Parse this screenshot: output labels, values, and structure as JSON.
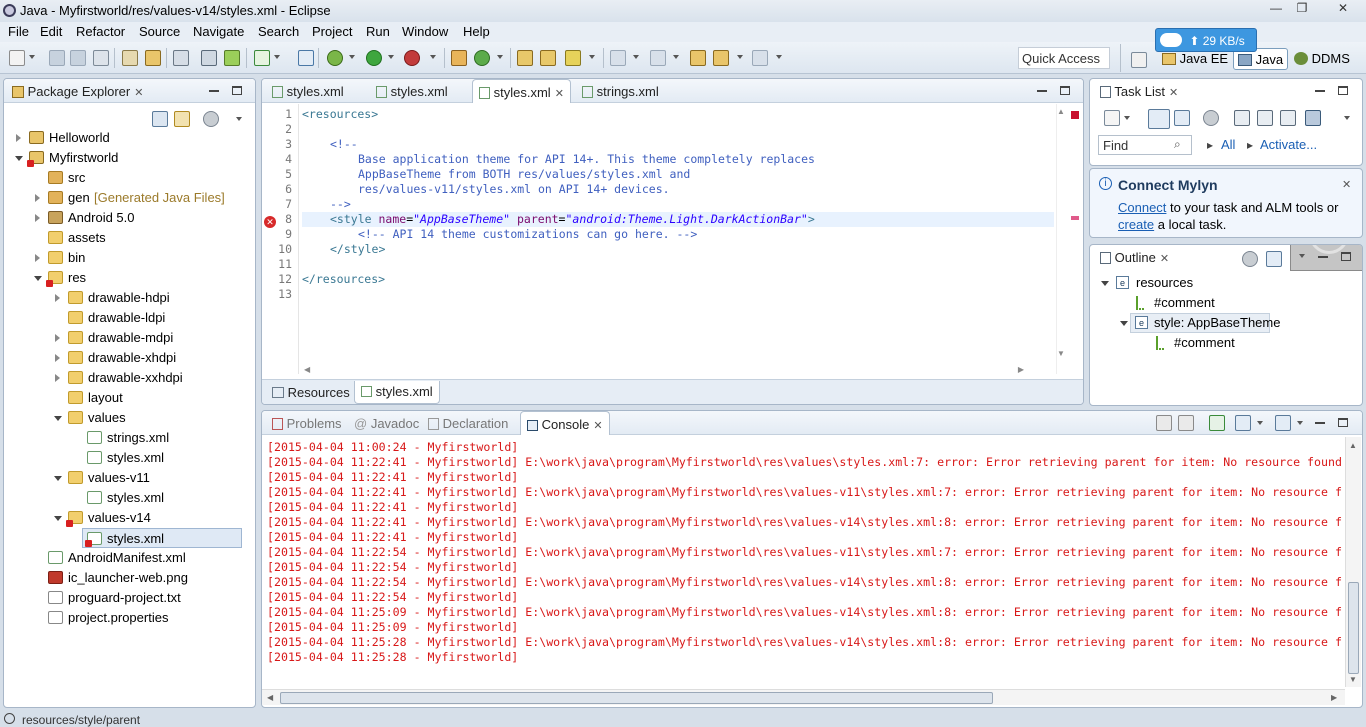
{
  "window": {
    "title": "Java - Myfirstworld/res/values-v14/styles.xml - Eclipse",
    "min": "—",
    "restore": "❐",
    "close": "✕"
  },
  "menu": [
    "File",
    "Edit",
    "Refactor",
    "Source",
    "Navigate",
    "Search",
    "Project",
    "Run",
    "Window",
    "Help"
  ],
  "toolbar": {
    "quick_access": "Quick Access",
    "speed": "⬆ 29 KB/s",
    "perspectives": [
      "Java EE",
      "Java",
      "DDMS"
    ]
  },
  "package_explorer": {
    "title": "Package Explorer",
    "items": [
      {
        "label": "Helloworld"
      },
      {
        "label": "Myfirstworld"
      },
      {
        "label": "src"
      },
      {
        "label": "gen",
        "extra": "[Generated Java Files]"
      },
      {
        "label": "Android 5.0"
      },
      {
        "label": "assets"
      },
      {
        "label": "bin"
      },
      {
        "label": "res"
      },
      {
        "label": "drawable-hdpi"
      },
      {
        "label": "drawable-ldpi"
      },
      {
        "label": "drawable-mdpi"
      },
      {
        "label": "drawable-xhdpi"
      },
      {
        "label": "drawable-xxhdpi"
      },
      {
        "label": "layout"
      },
      {
        "label": "values"
      },
      {
        "label": "strings.xml"
      },
      {
        "label": "styles.xml"
      },
      {
        "label": "values-v11"
      },
      {
        "label": "styles.xml"
      },
      {
        "label": "values-v14"
      },
      {
        "label": "styles.xml"
      },
      {
        "label": "AndroidManifest.xml"
      },
      {
        "label": "ic_launcher-web.png"
      },
      {
        "label": "proguard-project.txt"
      },
      {
        "label": "project.properties"
      }
    ]
  },
  "editor": {
    "tabs": [
      "styles.xml",
      "styles.xml",
      "styles.xml",
      "strings.xml"
    ],
    "line_numbers": [
      "1",
      "2",
      "3",
      "4",
      "5",
      "6",
      "7",
      "8",
      "9",
      "10",
      "11",
      "12",
      "13"
    ],
    "lines": {
      "l1": "<resources>",
      "l3": "<!--",
      "l4": "Base application theme for API 14+. This theme completely replaces",
      "l5": "AppBaseTheme from BOTH res/values/styles.xml and",
      "l6": "res/values-v11/styles.xml on API 14+ devices.",
      "l7": "-->",
      "l8_tag": "<style",
      "l8_a1": "name",
      "l8_v1": "\"AppBaseTheme\"",
      "l8_a2": "parent",
      "l8_v2": "\"android:Theme.Light.DarkActionBar\"",
      "l8_end": ">",
      "l9": "<!-- API 14 theme customizations can go here. -->",
      "l10": "</style>",
      "l12": "</resources>",
      "eq": "="
    },
    "bottom_tabs": [
      "Resources",
      "styles.xml"
    ]
  },
  "tasklist": {
    "title": "Task List",
    "find": "Find",
    "all": "All",
    "activate": "Activate..."
  },
  "mylyn": {
    "title": "Connect Mylyn",
    "connect": "Connect",
    "text1": " to your task and ALM tools or",
    "create": "create",
    "text2": " a local task."
  },
  "outline": {
    "title": "Outline",
    "items": [
      "resources",
      "#comment",
      "style: AppBaseTheme",
      "#comment"
    ]
  },
  "console": {
    "tabs": [
      "Problems",
      "Javadoc",
      "Declaration",
      "Console"
    ],
    "lines": [
      "[2015-04-04 11:00:24 - Myfirstworld]",
      "[2015-04-04 11:22:41 - Myfirstworld] E:\\work\\java\\program\\Myfirstworld\\res\\values\\styles.xml:7: error: Error retrieving parent for item: No resource found",
      "[2015-04-04 11:22:41 - Myfirstworld]",
      "[2015-04-04 11:22:41 - Myfirstworld] E:\\work\\java\\program\\Myfirstworld\\res\\values-v11\\styles.xml:7: error: Error retrieving parent for item: No resource f",
      "[2015-04-04 11:22:41 - Myfirstworld]",
      "[2015-04-04 11:22:41 - Myfirstworld] E:\\work\\java\\program\\Myfirstworld\\res\\values-v14\\styles.xml:8: error: Error retrieving parent for item: No resource f",
      "[2015-04-04 11:22:41 - Myfirstworld]",
      "[2015-04-04 11:22:54 - Myfirstworld] E:\\work\\java\\program\\Myfirstworld\\res\\values-v11\\styles.xml:7: error: Error retrieving parent for item: No resource f",
      "[2015-04-04 11:22:54 - Myfirstworld]",
      "[2015-04-04 11:22:54 - Myfirstworld] E:\\work\\java\\program\\Myfirstworld\\res\\values-v14\\styles.xml:8: error: Error retrieving parent for item: No resource f",
      "[2015-04-04 11:22:54 - Myfirstworld]",
      "[2015-04-04 11:25:09 - Myfirstworld] E:\\work\\java\\program\\Myfirstworld\\res\\values-v14\\styles.xml:8: error: Error retrieving parent for item: No resource f",
      "[2015-04-04 11:25:09 - Myfirstworld]",
      "[2015-04-04 11:25:28 - Myfirstworld] E:\\work\\java\\program\\Myfirstworld\\res\\values-v14\\styles.xml:8: error: Error retrieving parent for item: No resource f",
      "[2015-04-04 11:25:28 - Myfirstworld]"
    ]
  },
  "status": {
    "path": "resources/style/parent"
  }
}
